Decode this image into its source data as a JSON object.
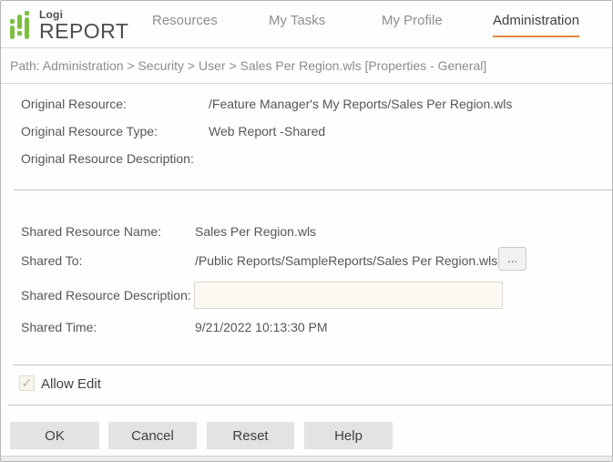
{
  "colors": {
    "accent-orange": "#e8883c",
    "brand-green": "#7cbf42"
  },
  "brand": {
    "logo_top": "Logi",
    "logo_main": "REPORT"
  },
  "nav": {
    "items": [
      {
        "label": "Resources",
        "active": false
      },
      {
        "label": "My Tasks",
        "active": false
      },
      {
        "label": "My Profile",
        "active": false
      },
      {
        "label": "Administration",
        "active": true
      }
    ]
  },
  "breadcrumb": {
    "text": "Path: Administration > Security > User > Sales Per Region.wls [Properties - General]"
  },
  "original": {
    "resource_label": "Original Resource:",
    "resource_value": "/Feature Manager's My Reports/Sales Per Region.wls",
    "type_label": "Original Resource Type:",
    "type_value": "Web Report -Shared",
    "description_label": "Original Resource Description:",
    "description_value": ""
  },
  "shared": {
    "name_label": "Shared Resource Name:",
    "name_value": "Sales Per Region.wls",
    "to_label": "Shared To:",
    "to_value": "/Public Reports/SampleReports/Sales Per Region.wls",
    "browse_button_label": "...",
    "description_label": "Shared Resource Description:",
    "description_value": "",
    "time_label": "Shared Time:",
    "time_value": "9/21/2022 10:13:30 PM"
  },
  "options": {
    "allow_edit_label": "Allow Edit",
    "allow_edit_checked": true,
    "check_glyph": "✓"
  },
  "buttons": [
    {
      "label": "OK"
    },
    {
      "label": "Cancel"
    },
    {
      "label": "Reset"
    },
    {
      "label": "Help"
    }
  ]
}
